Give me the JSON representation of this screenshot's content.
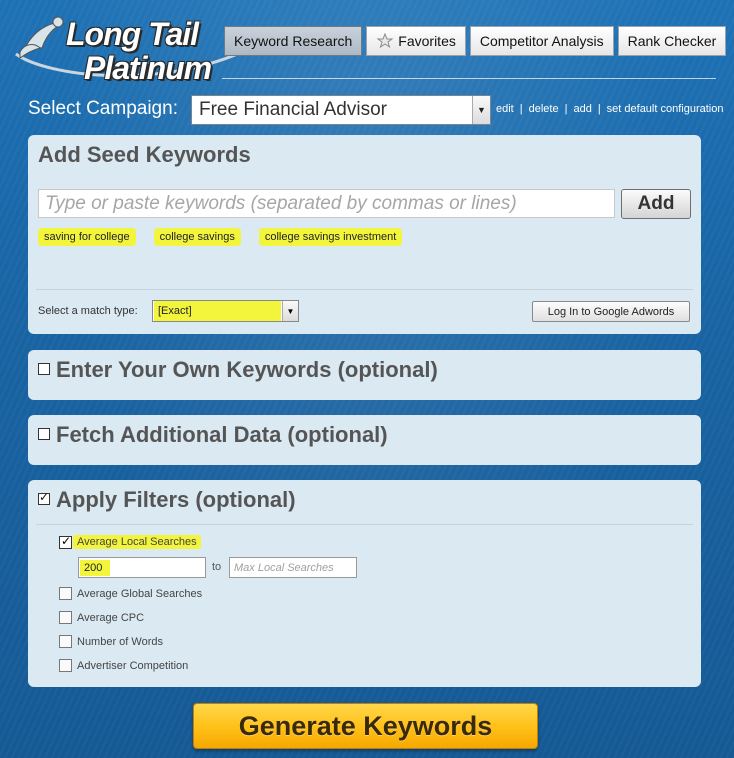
{
  "logo": {
    "line1": "Long Tail",
    "line2": "Platinum"
  },
  "tabs": [
    {
      "label": "Keyword Research",
      "active": true
    },
    {
      "label": "Favorites",
      "icon": "favorites-icon"
    },
    {
      "label": "Competitor Analysis"
    },
    {
      "label": "Rank Checker"
    }
  ],
  "campaign": {
    "label": "Select Campaign:",
    "selected": "Free Financial Advisor",
    "links": [
      "edit",
      "delete",
      "add",
      "set default configuration"
    ]
  },
  "seed": {
    "title": "Add Seed Keywords",
    "input_placeholder": "Type or paste keywords (separated by commas or lines)",
    "add_label": "Add",
    "keywords": [
      "saving for college",
      "college savings",
      "college savings investment"
    ],
    "match_label": "Select a match type:",
    "match_value": "[Exact]",
    "login_label": "Log In to Google Adwords"
  },
  "own_keywords": {
    "title": "Enter Your Own Keywords (optional)",
    "checked": false
  },
  "fetch_data": {
    "title": "Fetch Additional Data (optional)",
    "checked": false
  },
  "filters": {
    "title": "Apply Filters (optional)",
    "checked": true,
    "items": [
      {
        "label": "Average Local Searches",
        "checked": true
      },
      {
        "label": "Average Global Searches",
        "checked": false
      },
      {
        "label": "Average CPC",
        "checked": false
      },
      {
        "label": "Number of Words",
        "checked": false
      },
      {
        "label": "Advertiser Competition",
        "checked": false
      }
    ],
    "min_value": "200",
    "to_label": "to",
    "max_placeholder": "Max Local Searches"
  },
  "generate_label": "Generate Keywords",
  "colors": {
    "highlight": "#f2f53c",
    "background": "#1a66a6",
    "panel": "#dbe9f3",
    "button": "#ffc21a"
  }
}
